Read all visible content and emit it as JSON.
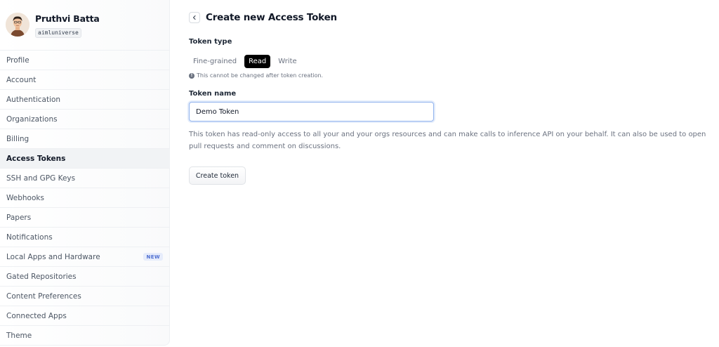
{
  "profile": {
    "name": "Pruthvi Batta",
    "username": "aimluniverse"
  },
  "sidebar": {
    "items": [
      {
        "label": "Profile"
      },
      {
        "label": "Account"
      },
      {
        "label": "Authentication"
      },
      {
        "label": "Organizations"
      },
      {
        "label": "Billing"
      },
      {
        "label": "Access Tokens",
        "active": true
      },
      {
        "label": "SSH and GPG Keys"
      },
      {
        "label": "Webhooks"
      },
      {
        "label": "Papers"
      },
      {
        "label": "Notifications"
      },
      {
        "label": "Local Apps and Hardware",
        "badge": "NEW"
      },
      {
        "label": "Gated Repositories"
      },
      {
        "label": "Content Preferences"
      },
      {
        "label": "Connected Apps"
      },
      {
        "label": "Theme"
      }
    ]
  },
  "main": {
    "title": "Create new Access Token",
    "token_type_label": "Token type",
    "tabs": [
      {
        "label": "Fine-grained"
      },
      {
        "label": "Read",
        "selected": true
      },
      {
        "label": "Write"
      }
    ],
    "info_note": "This cannot be changed after token creation.",
    "token_name_label": "Token name",
    "token_name_value": "Demo Token",
    "description": "This token has read-only access to all your and your orgs resources and can make calls to inference API on your behalf. It can also be used to open pull requests and comment on discussions.",
    "create_button": "Create token"
  },
  "colors": {
    "active_tab_bg": "#000000",
    "badge_text": "#4f6fd1",
    "input_focus_border": "#93b4ee"
  }
}
